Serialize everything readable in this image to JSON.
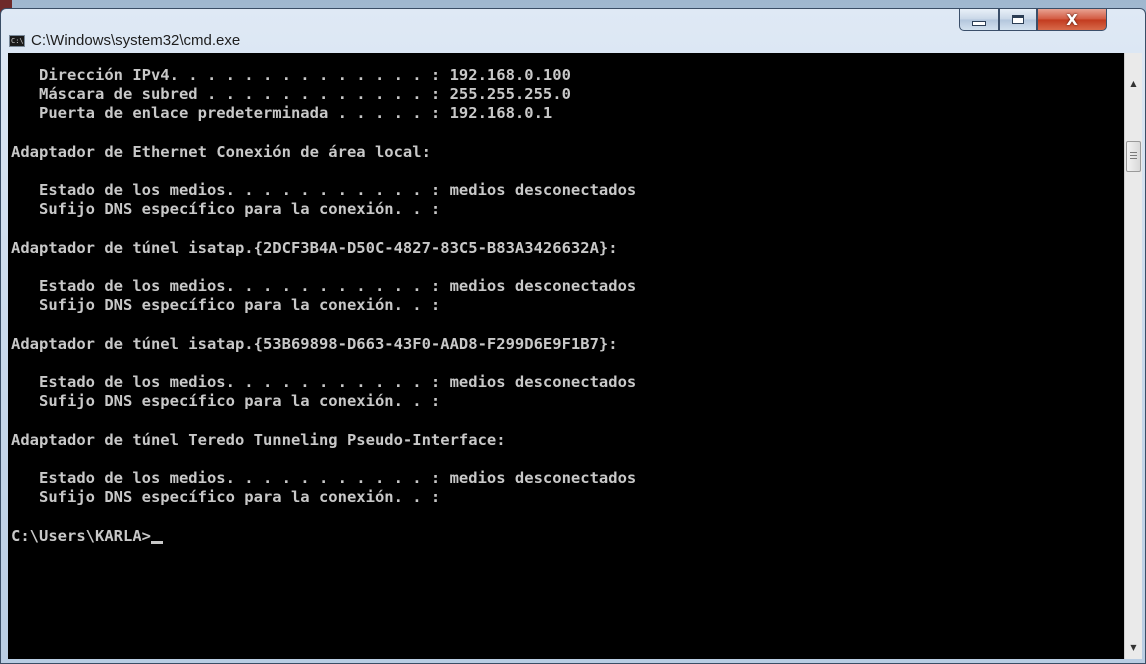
{
  "window": {
    "title": "C:\\Windows\\system32\\cmd.exe",
    "icon_label": "C:\\",
    "controls": {
      "minimize": "minimize",
      "maximize": "maximize",
      "close": "X"
    }
  },
  "console": {
    "lines": [
      "   Dirección IPv4. . . . . . . . . . . . . . : 192.168.0.100",
      "   Máscara de subred . . . . . . . . . . . . : 255.255.255.0",
      "   Puerta de enlace predeterminada . . . . . : 192.168.0.1",
      "",
      "Adaptador de Ethernet Conexión de área local:",
      "",
      "   Estado de los medios. . . . . . . . . . . : medios desconectados",
      "   Sufijo DNS específico para la conexión. . :",
      "",
      "Adaptador de túnel isatap.{2DCF3B4A-D50C-4827-83C5-B83A3426632A}:",
      "",
      "   Estado de los medios. . . . . . . . . . . : medios desconectados",
      "   Sufijo DNS específico para la conexión. . :",
      "",
      "Adaptador de túnel isatap.{53B69898-D663-43F0-AAD8-F299D6E9F1B7}:",
      "",
      "   Estado de los medios. . . . . . . . . . . : medios desconectados",
      "   Sufijo DNS específico para la conexión. . :",
      "",
      "Adaptador de túnel Teredo Tunneling Pseudo-Interface:",
      "",
      "   Estado de los medios. . . . . . . . . . . : medios desconectados",
      "   Sufijo DNS específico para la conexión. . :",
      ""
    ],
    "prompt": "C:\\Users\\KARLA>"
  },
  "scrollbar": {
    "up_arrow": "▲",
    "down_arrow": "▼"
  },
  "colors": {
    "console_bg": "#000000",
    "console_fg": "#c8c8c8",
    "close_button": "#c8452a"
  }
}
